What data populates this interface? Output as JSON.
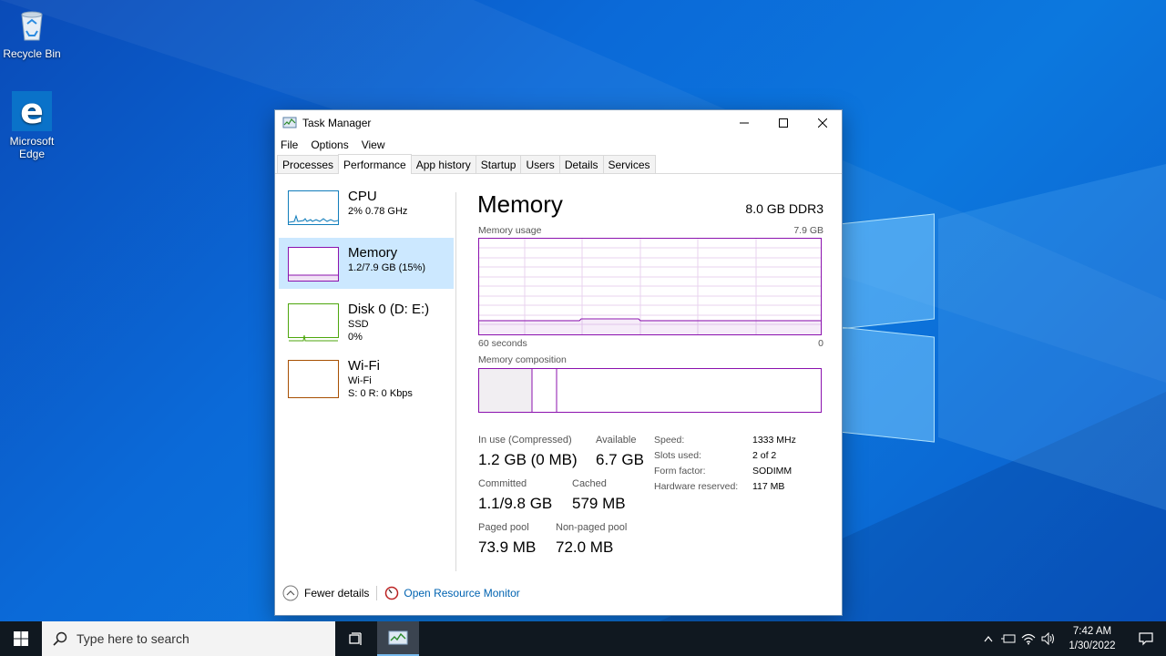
{
  "desktop": {
    "icons": [
      {
        "label": "Recycle Bin"
      },
      {
        "label": "Microsoft Edge"
      }
    ]
  },
  "window": {
    "title": "Task Manager",
    "menu": [
      "File",
      "Options",
      "View"
    ],
    "tabs": [
      "Processes",
      "Performance",
      "App history",
      "Startup",
      "Users",
      "Details",
      "Services"
    ],
    "active_tab": "Performance"
  },
  "resources": [
    {
      "name": "CPU",
      "sub1": "2%  0.78 GHz",
      "sub2": "",
      "color": "#117dbb"
    },
    {
      "name": "Memory",
      "sub1": "1.2/7.9 GB (15%)",
      "sub2": "",
      "color": "#8b12ae"
    },
    {
      "name": "Disk 0 (D: E:)",
      "sub1": "SSD",
      "sub2": "0%",
      "color": "#4da60c"
    },
    {
      "name": "Wi-Fi",
      "sub1": "Wi-Fi",
      "sub2": "S: 0  R: 0 Kbps",
      "color": "#a74f01"
    }
  ],
  "memory": {
    "title": "Memory",
    "type": "8.0 GB DDR3",
    "usage_label": "Memory usage",
    "usage_max": "7.9 GB",
    "axis_left": "60 seconds",
    "axis_right": "0",
    "composition_label": "Memory composition",
    "usage_fraction": 0.15,
    "stats": {
      "in_use_label": "In use (Compressed)",
      "in_use_value": "1.2 GB (0 MB)",
      "available_label": "Available",
      "available_value": "6.7 GB",
      "committed_label": "Committed",
      "committed_value": "1.1/9.8 GB",
      "cached_label": "Cached",
      "cached_value": "579 MB",
      "paged_label": "Paged pool",
      "paged_value": "73.9 MB",
      "nonpaged_label": "Non-paged pool",
      "nonpaged_value": "72.0 MB"
    },
    "specs": {
      "speed_label": "Speed:",
      "speed_value": "1333 MHz",
      "slots_label": "Slots used:",
      "slots_value": "2 of 2",
      "form_label": "Form factor:",
      "form_value": "SODIMM",
      "hwres_label": "Hardware reserved:",
      "hwres_value": "117 MB"
    }
  },
  "footer": {
    "fewer_details": "Fewer details",
    "open_resmon": "Open Resource Monitor"
  },
  "taskbar": {
    "search_placeholder": "Type here to search",
    "time": "7:42 AM",
    "date": "1/30/2022"
  }
}
